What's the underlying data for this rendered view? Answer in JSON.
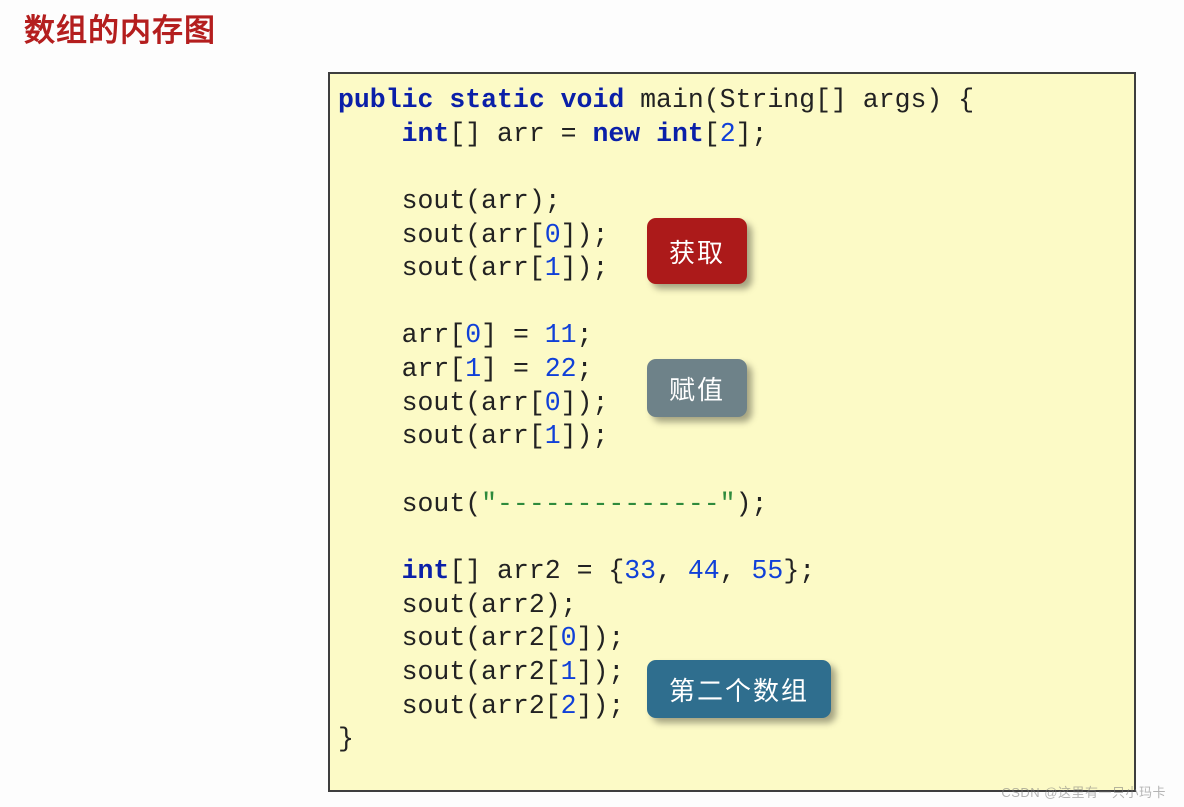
{
  "title": "数组的内存图",
  "code": {
    "l1": {
      "a": "public static void",
      "b": " main(String[] args) {"
    },
    "l2": {
      "a": "    ",
      "kw1": "int",
      "b": "[] arr = ",
      "kw2": "new int",
      "c": "[",
      "n": "2",
      "d": "];"
    },
    "l3": "",
    "l4": "    sout(arr);",
    "l5": {
      "a": "    sout(arr[",
      "n": "0",
      "b": "]);"
    },
    "l6": {
      "a": "    sout(arr[",
      "n": "1",
      "b": "]);"
    },
    "l7": "",
    "l8": {
      "a": "    arr[",
      "n": "0",
      "b": "] = ",
      "v": "11",
      "c": ";"
    },
    "l9": {
      "a": "    arr[",
      "n": "1",
      "b": "] = ",
      "v": "22",
      "c": ";"
    },
    "l10": {
      "a": "    sout(arr[",
      "n": "0",
      "b": "]);"
    },
    "l11": {
      "a": "    sout(arr[",
      "n": "1",
      "b": "]);"
    },
    "l12": "",
    "l13": {
      "a": "    sout(",
      "s": "\"--------------\"",
      "b": ");"
    },
    "l14": "",
    "l15": {
      "a": "    ",
      "kw": "int",
      "b": "[] arr2 = {",
      "n1": "33",
      "c1": ", ",
      "n2": "44",
      "c2": ", ",
      "n3": "55",
      "d": "};"
    },
    "l16": "    sout(arr2);",
    "l17": {
      "a": "    sout(arr2[",
      "n": "0",
      "b": "]);"
    },
    "l18": {
      "a": "    sout(arr2[",
      "n": "1",
      "b": "]);"
    },
    "l19": {
      "a": "    sout(arr2[",
      "n": "2",
      "b": "]);"
    },
    "l20": "}"
  },
  "badges": {
    "get": "获取",
    "set": "赋值",
    "second": "第二个数组"
  },
  "watermark": "CSDN @这里有一只小玛卡"
}
